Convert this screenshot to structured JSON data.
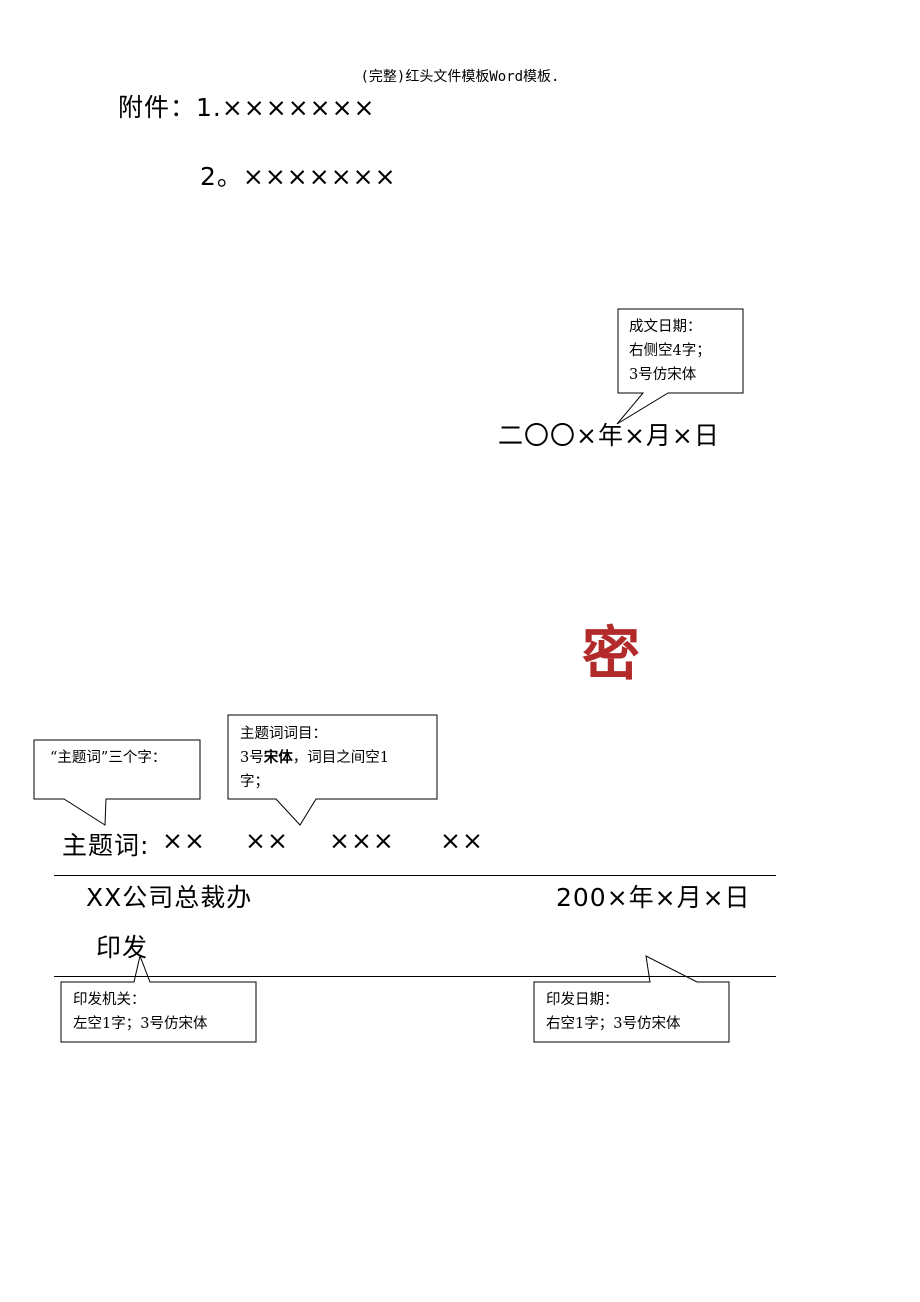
{
  "header": {
    "document_title": "(完整)红头文件模板Word模板."
  },
  "attachments": {
    "line1": "附件：1.×××××××",
    "line2": "2。×××××××"
  },
  "date_callout": {
    "lines": [
      "成文日期：",
      "右侧空4字；",
      "3号仿宋体"
    ]
  },
  "issue_date": "二〇〇×年×月×日",
  "seal": {
    "char": "密",
    "color": "#b22a2a"
  },
  "subject_callout_left": {
    "text": "“主题词”三个字："
  },
  "subject_callout_right": {
    "line1_prefix": "3号",
    "line1_bold": "宋体",
    "line1_suffix": "，词目之间空1",
    "title": "主题词词目：",
    "line2": "字；"
  },
  "subject_words": {
    "label": "主题词:",
    "items": [
      "××",
      "××",
      "×××",
      "××"
    ]
  },
  "footer": {
    "issuer": "XX公司总裁办",
    "issuer_suffix": "印发",
    "print_date": "200×年×月×日"
  },
  "issuer_callout": {
    "lines": [
      "印发机关：",
      "左空1字；3号仿宋体"
    ]
  },
  "print_date_callout": {
    "lines": [
      "印发日期：",
      "右空1字；3号仿宋体"
    ]
  }
}
